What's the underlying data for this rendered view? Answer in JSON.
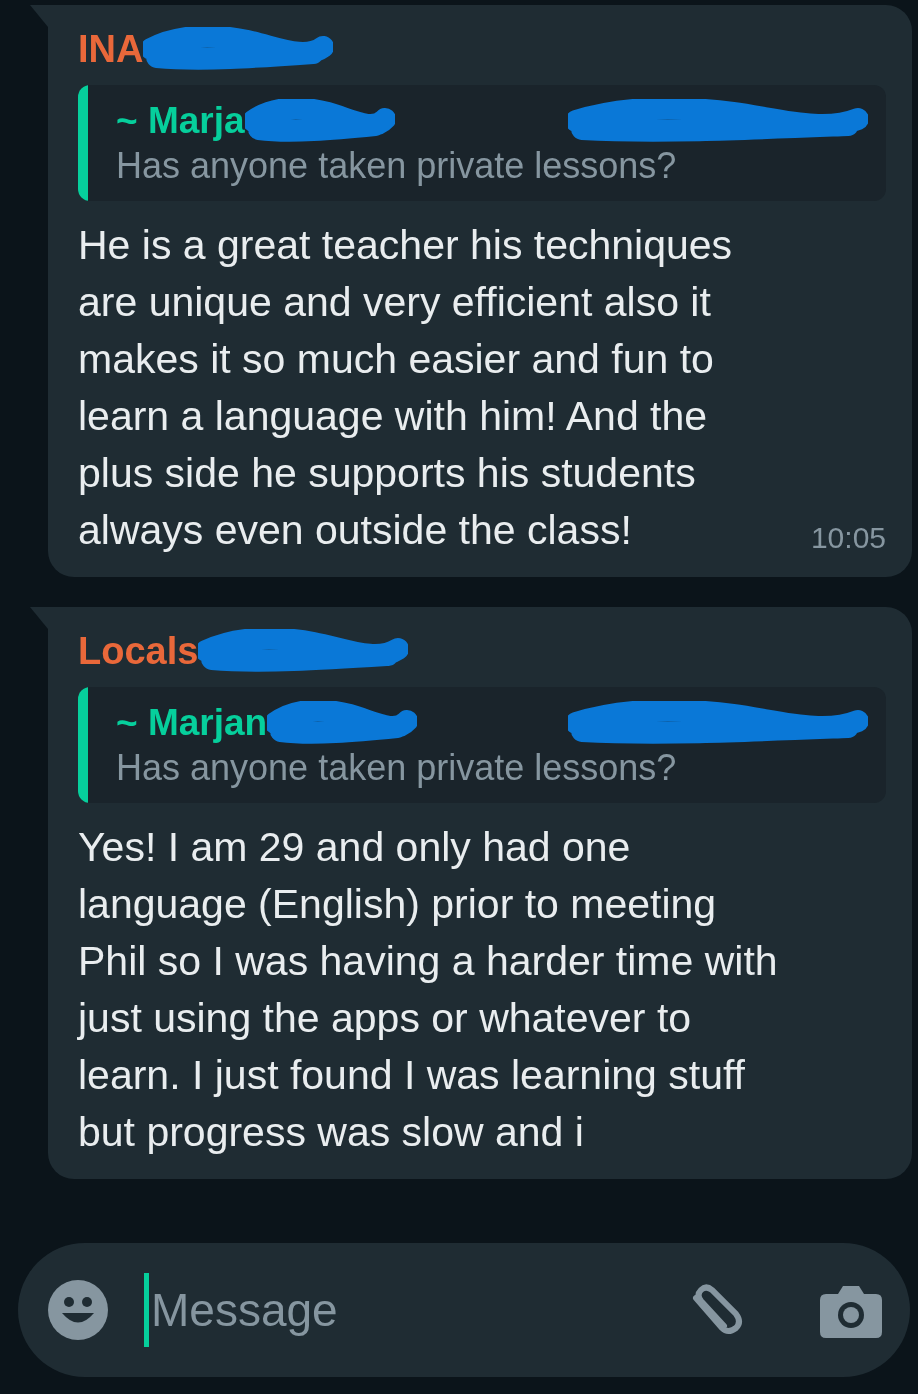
{
  "messages": [
    {
      "sender": "INA",
      "quote": {
        "author": "~ Marja",
        "text": "Has anyone taken private lessons?"
      },
      "text": "He is a great teacher his techniques are unique and very efficient also it makes it so much easier and fun to learn a language with him! And the plus side he supports his students always even outside the class!",
      "time": "10:05"
    },
    {
      "sender": "Locals",
      "quote": {
        "author": "~ Marjan",
        "text": "Has anyone taken private lessons?"
      },
      "text": "Yes! I am 29 and only had one language (English) prior to meeting Phil so I was having a harder time with just using the apps or whatever to learn. I just found I was learning stuff but progress was slow and i"
    }
  ],
  "composer": {
    "placeholder": "Message"
  }
}
